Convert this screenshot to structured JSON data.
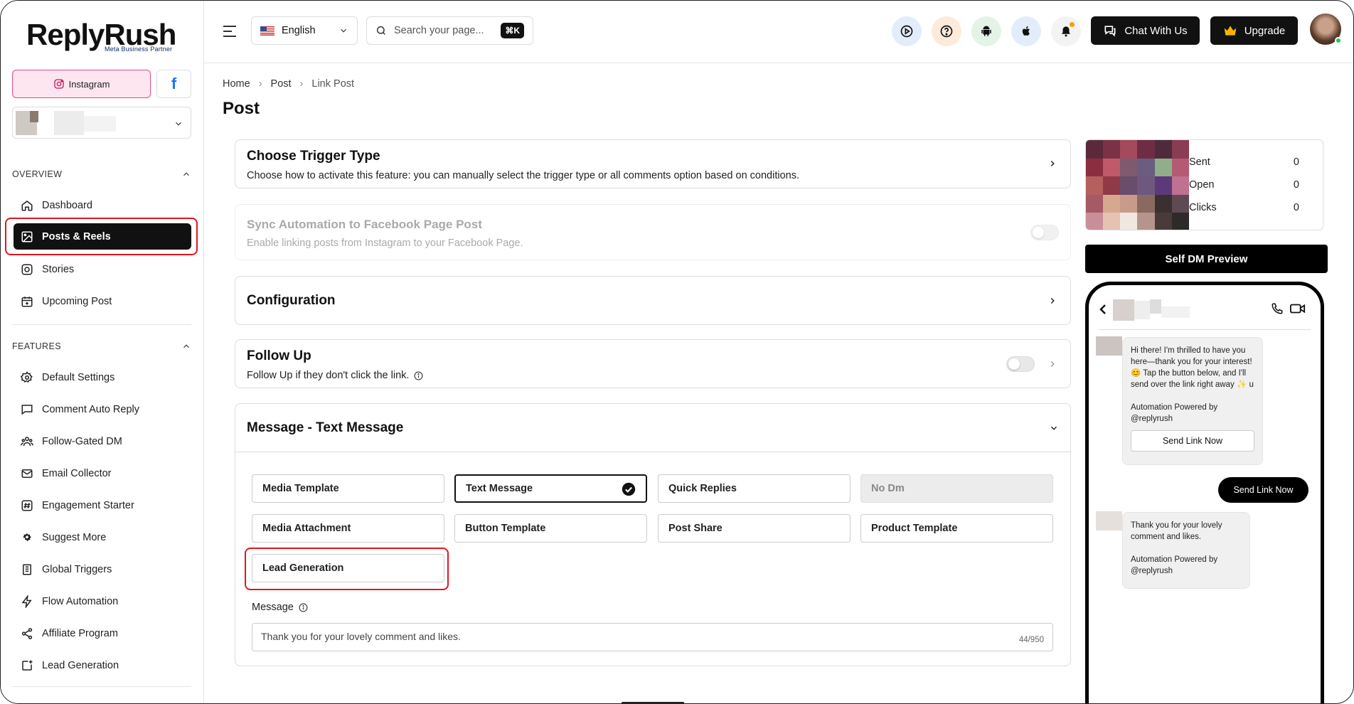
{
  "brand": {
    "name": "ReplyRush",
    "partner": "Meta Business Partner"
  },
  "platforms": {
    "instagram": "Instagram",
    "facebook": "f"
  },
  "sidebar": {
    "overview_label": "OVERVIEW",
    "overview_items": [
      {
        "label": "Dashboard",
        "icon": "home-icon"
      },
      {
        "label": "Posts & Reels",
        "icon": "image-icon",
        "active": true
      },
      {
        "label": "Stories",
        "icon": "instagram-icon"
      },
      {
        "label": "Upcoming Post",
        "icon": "calendar-plus-icon"
      }
    ],
    "features_label": "FEATURES",
    "feature_items": [
      {
        "label": "Default Settings",
        "icon": "gear-icon"
      },
      {
        "label": "Comment Auto Reply",
        "icon": "comment-icon"
      },
      {
        "label": "Follow-Gated DM",
        "icon": "users-icon"
      },
      {
        "label": "Email Collector",
        "icon": "mail-icon"
      },
      {
        "label": "Engagement Starter",
        "icon": "hashtag-icon"
      },
      {
        "label": "Suggest More",
        "icon": "cog-spark-icon"
      },
      {
        "label": "Global Triggers",
        "icon": "book-icon"
      },
      {
        "label": "Flow Automation",
        "icon": "bolt-icon"
      },
      {
        "label": "Affiliate Program",
        "icon": "share-icon"
      },
      {
        "label": "Lead Generation",
        "icon": "add-square-icon"
      }
    ]
  },
  "topbar": {
    "language": "English",
    "search_placeholder": "Search your page...",
    "shortcut": "⌘K",
    "chat_label": "Chat With Us",
    "upgrade_label": "Upgrade"
  },
  "breadcrumb": [
    "Home",
    "Post",
    "Link Post"
  ],
  "page_title": "Post",
  "trigger": {
    "title": "Choose Trigger Type",
    "desc": "Choose how to activate this feature: you can manually select the trigger type or all comments option based on conditions."
  },
  "sync": {
    "title": "Sync Automation to Facebook Page Post",
    "desc": "Enable linking posts from Instagram to your Facebook Page."
  },
  "configuration": {
    "title": "Configuration"
  },
  "followup": {
    "title": "Follow Up",
    "desc": "Follow Up if they don't click the link."
  },
  "message_section": {
    "title": "Message - Text Message",
    "options": [
      "Media Template",
      "Text Message",
      "Quick Replies",
      "No Dm",
      "Media Attachment",
      "Button Template",
      "Post Share",
      "Product Template",
      "Lead Generation"
    ],
    "message_label": "Message",
    "message_value": "Thank you for your lovely comment and likes.",
    "char_count": "44/950"
  },
  "stats": {
    "rows": [
      {
        "label": "Sent",
        "value": "0"
      },
      {
        "label": "Open",
        "value": "0"
      },
      {
        "label": "Clicks",
        "value": "0"
      }
    ]
  },
  "preview": {
    "button_label": "Self DM Preview",
    "bubble1": "Hi there! I'm thrilled to have you here—thank you for your interest! 😊 Tap the button below, and I'll send over the link right away ✨ u",
    "powered1": "Automation Powered by @replyrush",
    "send_link": "Send Link Now",
    "reply_button": "Send Link Now",
    "bubble2": "Thank you for your lovely comment and likes.",
    "powered2": "Automation Powered by @replyrush"
  },
  "colors": {
    "accent_red": "#e0161f",
    "dark": "#111111",
    "ig_pink": "#fde6f0",
    "fb_blue": "#1877f2"
  }
}
